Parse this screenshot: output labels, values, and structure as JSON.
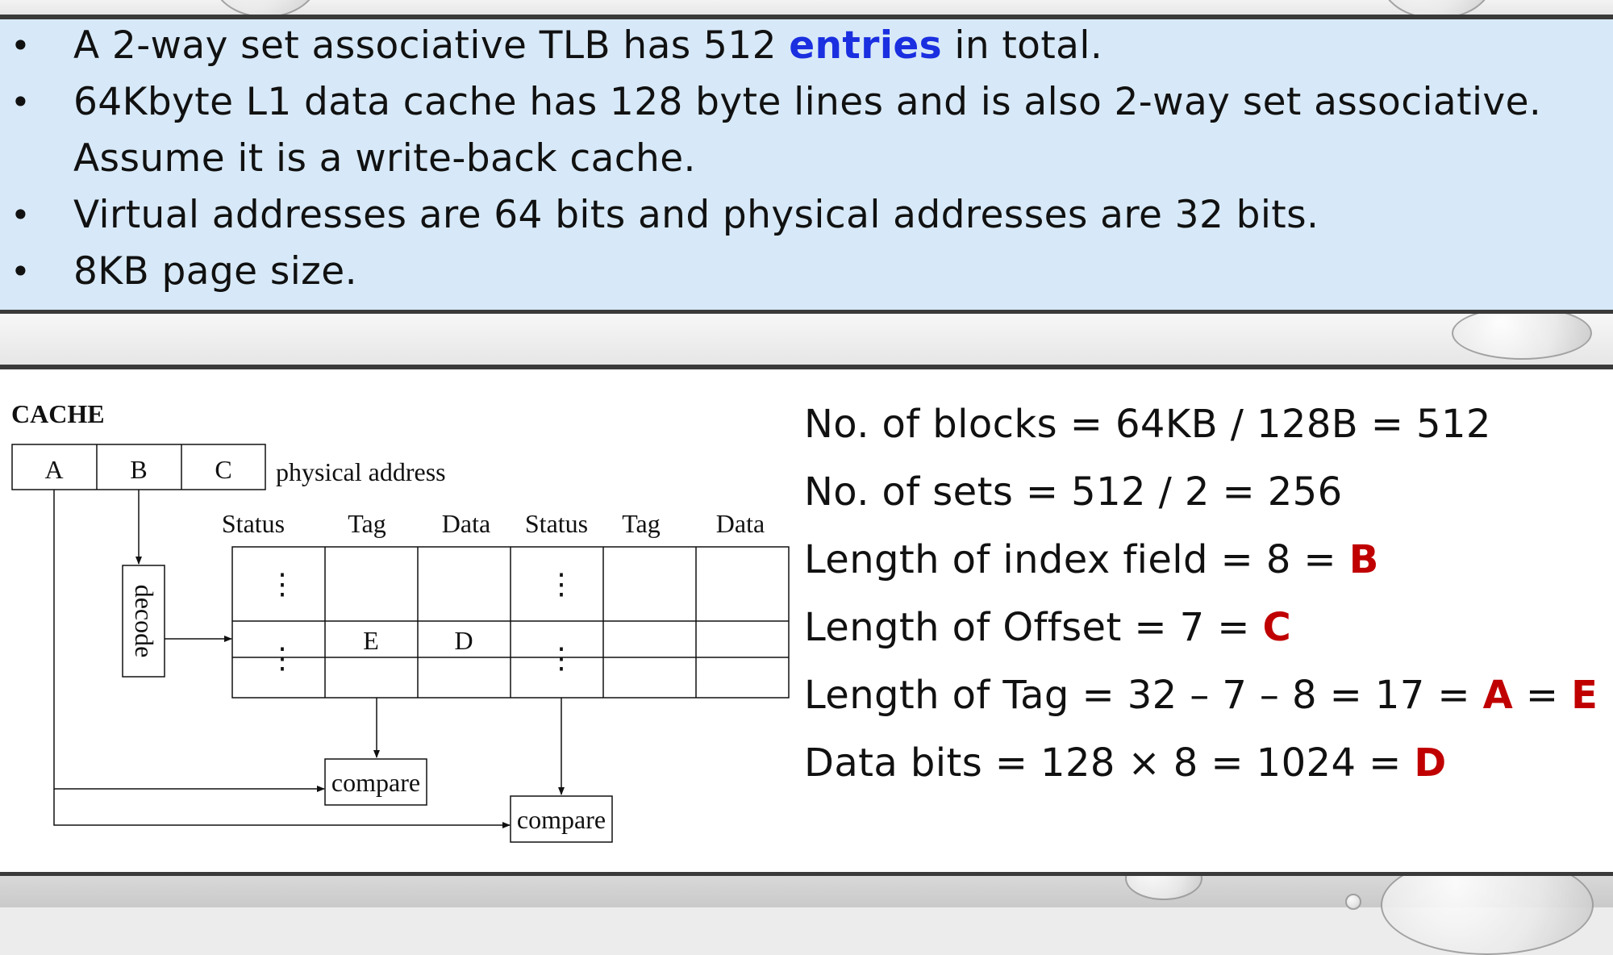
{
  "question": {
    "bullets": [
      {
        "before": "A 2-way set associative TLB has 512 ",
        "keyword": "entries",
        "after": " in total."
      },
      {
        "before": "64Kbyte L1 data cache has 128 byte lines and is also 2-way set associative.",
        "keyword": "",
        "after": ""
      },
      {
        "before": "Virtual addresses are 64 bits and physical addresses are 32 bits.",
        "keyword": "",
        "after": ""
      },
      {
        "before": "8KB page size.",
        "keyword": "",
        "after": ""
      }
    ],
    "continuation": "Assume it is a write-back cache.",
    "bullet_symbol": "•",
    "keyword_color": "#1a2fe0"
  },
  "diagram": {
    "title": "CACHE",
    "address_fields": [
      "A",
      "B",
      "C"
    ],
    "address_label": "physical address",
    "column_headers": [
      "Status",
      "Tag",
      "Data",
      "Status",
      "Tag",
      "Data"
    ],
    "decoder_label": "decode",
    "selected_row": [
      "",
      "E",
      "D",
      "",
      "",
      ""
    ],
    "ellipsis": "⋮",
    "comparator_labels": [
      "compare",
      "compare"
    ]
  },
  "calculations": [
    {
      "text": "No. of blocks = 64KB / 128B = 512",
      "tail": []
    },
    {
      "text": "No. of sets = 512 / 2 = 256",
      "tail": []
    },
    {
      "text": "Length of index field = 8 = ",
      "tail": [
        {
          "text": "B",
          "hl": true
        }
      ]
    },
    {
      "text": "Length of Offset = 7 = ",
      "tail": [
        {
          "text": "C",
          "hl": true
        }
      ]
    },
    {
      "text": "Length of Tag = 32 – 7 – 8 = 17 = ",
      "tail": [
        {
          "text": "A",
          "hl": true
        },
        {
          "text": " = ",
          "hl": false
        },
        {
          "text": "E",
          "hl": true
        }
      ]
    },
    {
      "text": "Data bits = 128 × 8 = 1024 = ",
      "tail": [
        {
          "text": "D",
          "hl": true
        }
      ]
    }
  ],
  "colors": {
    "panel_blue": "#d7e9f8",
    "answer_red": "#c00000",
    "divider": "#3a3a3a"
  }
}
